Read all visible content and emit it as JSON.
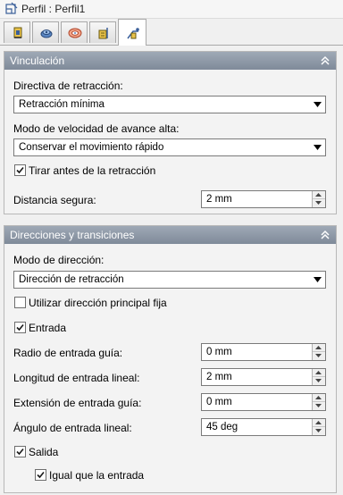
{
  "window": {
    "title": "Perfil : Perfil1"
  },
  "tabs": [
    {
      "icon": "tool-holder-icon",
      "active": false
    },
    {
      "icon": "cutting-layers-icon",
      "active": false
    },
    {
      "icon": "stock-icon",
      "active": false
    },
    {
      "icon": "passes-icon",
      "active": false
    },
    {
      "icon": "linking-icon",
      "active": true
    }
  ],
  "linking": {
    "title": "Vinculación",
    "retract_policy_label": "Directiva de retracción:",
    "retract_policy_value": "Retracción mínima",
    "high_feed_label": "Modo de velocidad de avance alta:",
    "high_feed_value": "Conservar el movimiento rápido",
    "pull_before_retract_label": "Tirar antes de la retracción",
    "pull_before_retract_checked": true,
    "safe_distance_label": "Distancia segura:",
    "safe_distance_value": "2 mm"
  },
  "directions": {
    "title": "Direcciones y transiciones",
    "direction_mode_label": "Modo de dirección:",
    "direction_mode_value": "Dirección de retracción",
    "fixed_direction_label": "Utilizar dirección principal fija",
    "fixed_direction_checked": false,
    "lead_in_label": "Entrada",
    "lead_in_checked": true,
    "lead_in_radius_label": "Radio de entrada guía:",
    "lead_in_radius_value": "0 mm",
    "linear_lead_in_length_label": "Longitud de entrada lineal:",
    "linear_lead_in_length_value": "2 mm",
    "lead_in_extension_label": "Extensión de entrada guía:",
    "lead_in_extension_value": "0 mm",
    "linear_lead_in_angle_label": "Ángulo de entrada lineal:",
    "linear_lead_in_angle_value": "45 deg",
    "lead_out_label": "Salida",
    "lead_out_checked": true,
    "same_as_lead_in_label": "Igual que la entrada",
    "same_as_lead_in_checked": true
  },
  "colors": {
    "panel_header": "#8893a2",
    "panel_background": "#f3f3f3",
    "window_background": "#f0f0f0"
  }
}
